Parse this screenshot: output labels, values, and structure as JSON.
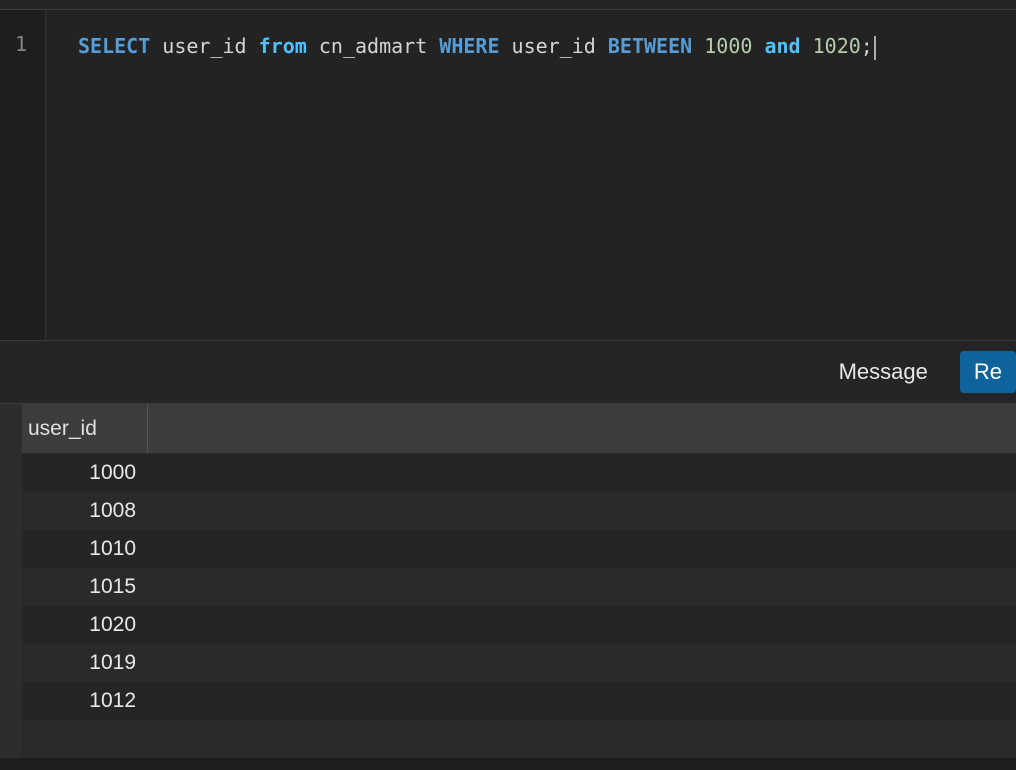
{
  "editor": {
    "line_number": "1",
    "sql": {
      "select": "SELECT",
      "col": "user_id",
      "from": "from",
      "table": "cn_admart",
      "where": "WHERE",
      "col2": "user_id",
      "between": "BETWEEN",
      "val1": "1000",
      "and": "and",
      "val2": "1020",
      "semi": ";"
    }
  },
  "tabs": {
    "message": "Message",
    "result": "Re"
  },
  "results": {
    "header": "user_id",
    "rows": [
      "1000",
      "1008",
      "1010",
      "1015",
      "1020",
      "1019",
      "1012"
    ]
  }
}
